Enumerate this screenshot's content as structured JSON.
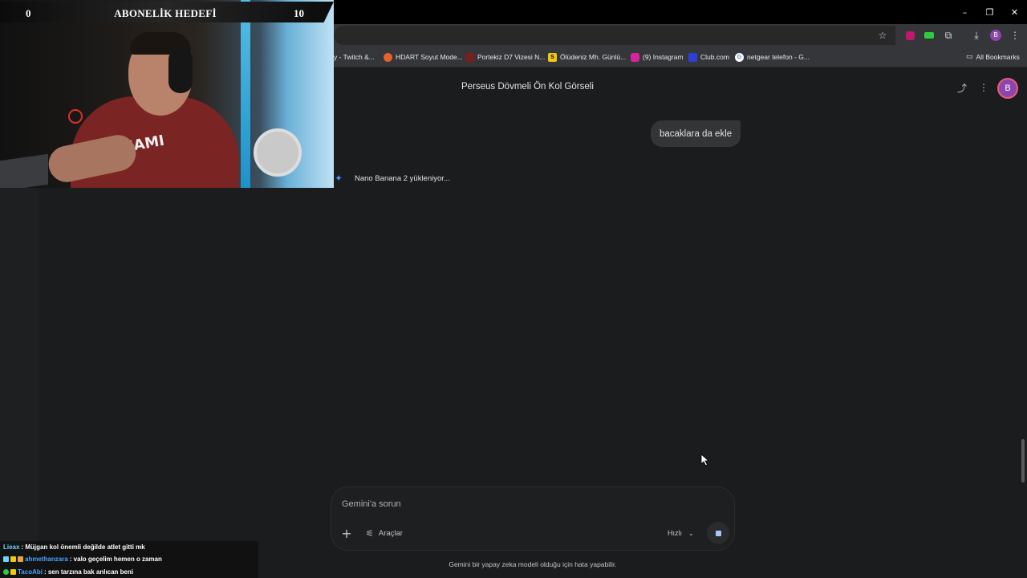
{
  "browser": {
    "window_controls": {
      "minimize": "–",
      "restore": "❐",
      "close": "✕"
    },
    "toolbar_icons": [
      "star-icon",
      "extension-icon",
      "download-icon",
      "menu-icon"
    ],
    "profile_initial": "B",
    "bookmarks": [
      {
        "label": "y - Twitch &...",
        "icon": "twitch-icon",
        "color": "#9146ff"
      },
      {
        "label": "HDART Soyut Mode...",
        "icon": "hdart-icon",
        "color": "#e8602a"
      },
      {
        "label": "Portekiz D7 Vizesi N...",
        "icon": "portekiz-icon",
        "color": "#7a1f1f"
      },
      {
        "label": "Ölüdeniz Mh. Günlü...",
        "icon": "s-icon",
        "color": "#f2c811"
      },
      {
        "label": "(9) Instagram",
        "icon": "instagram-icon",
        "color": "#d6249f"
      },
      {
        "label": "Club.com",
        "icon": "club-icon",
        "color": "#2f3fd6"
      },
      {
        "label": "netgear telefon - G...",
        "icon": "google-icon",
        "color": "#ffffff"
      }
    ],
    "all_bookmarks": "All Bookmarks"
  },
  "gemini": {
    "chat_title": "Perseus Dövmeli Ön Kol Görseli",
    "user_message": "bacaklara da ekle",
    "loading_text": "Nano Banana 2 yükleniyor...",
    "input_placeholder": "Gemini'a sorun",
    "tools_label": "Araçlar",
    "model_label": "Hızlı",
    "disclaimer": "Gemini bir yapay zeka modeli olduğu için hata yapabilir.",
    "avatar_initial": "B"
  },
  "overlay": {
    "goal_current": "0",
    "goal_title": "ABONELİK HEDEFİ",
    "goal_target": "10",
    "shirt_text": "MIAMI",
    "chat": [
      {
        "user": "Lieax",
        "color": "#6fd3ff",
        "message": ": Müjgan kol önemli değilde atlet gitti mk"
      },
      {
        "user": "ahmethanzara",
        "color": "#4aa3ff",
        "message": ": valo geçelim hemen o zaman"
      },
      {
        "user": "TacoAbi",
        "color": "#4aa3ff",
        "message": ": sen tarzına bak anlıcan beni"
      }
    ]
  }
}
